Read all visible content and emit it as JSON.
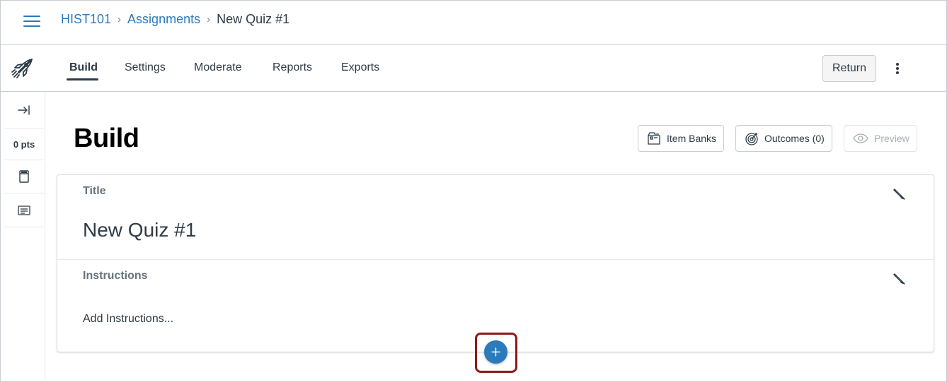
{
  "breadcrumb": {
    "course": "HIST101",
    "section": "Assignments",
    "current": "New Quiz #1",
    "separator": "›"
  },
  "tabs": [
    {
      "label": "Build",
      "active": true
    },
    {
      "label": "Settings",
      "active": false
    },
    {
      "label": "Moderate",
      "active": false
    },
    {
      "label": "Reports",
      "active": false
    },
    {
      "label": "Exports",
      "active": false
    }
  ],
  "header": {
    "return_label": "Return"
  },
  "rail": {
    "collapse_icon": "expand-panel-icon",
    "points": "0 pts",
    "items": [
      "document-icon",
      "text-block-icon"
    ]
  },
  "main": {
    "page_title": "Build",
    "buttons": {
      "item_banks": "Item Banks",
      "outcomes": "Outcomes (0)",
      "preview": "Preview"
    },
    "card": {
      "title_label": "Title",
      "title_value": "New Quiz #1",
      "instructions_label": "Instructions",
      "instructions_placeholder": "Add Instructions..."
    }
  },
  "colors": {
    "link": "#2b7abc",
    "text": "#2d3b45",
    "highlight": "#8b1a1a",
    "add_button": "#2b7abc"
  }
}
